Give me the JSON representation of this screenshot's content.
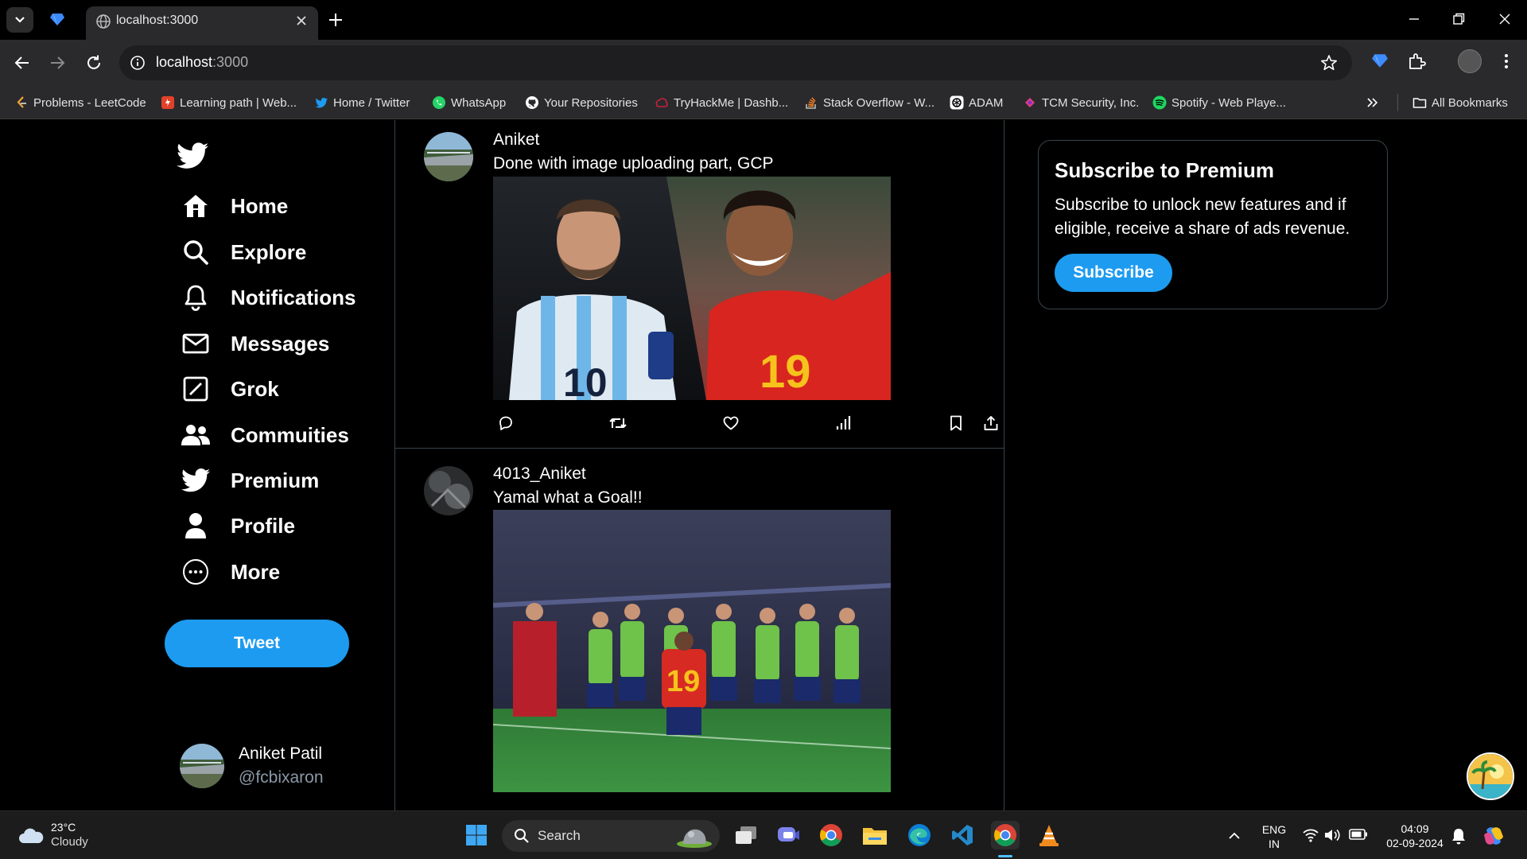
{
  "browser": {
    "tab": {
      "title": "localhost:3000"
    },
    "url": {
      "host": "localhost",
      "port": ":3000"
    },
    "bookmarks": [
      {
        "label": "Problems - LeetCode",
        "icon": "leetcode-icon"
      },
      {
        "label": "Learning path | Web...",
        "icon": "learning-icon"
      },
      {
        "label": "Home / Twitter",
        "icon": "twitter-icon"
      },
      {
        "label": "WhatsApp",
        "icon": "whatsapp-icon"
      },
      {
        "label": "Your Repositories",
        "icon": "github-icon"
      },
      {
        "label": "TryHackMe | Dashb...",
        "icon": "tryhackme-icon"
      },
      {
        "label": "Stack Overflow - W...",
        "icon": "stackoverflow-icon"
      },
      {
        "label": "ADAM",
        "icon": "openai-icon"
      },
      {
        "label": "TCM Security, Inc.",
        "icon": "tcm-icon"
      },
      {
        "label": "Spotify - Web Playe...",
        "icon": "spotify-icon"
      }
    ],
    "all_bookmarks": "All Bookmarks"
  },
  "sidebar": {
    "nav": [
      {
        "label": "Home",
        "icon": "home-icon"
      },
      {
        "label": "Explore",
        "icon": "search-icon"
      },
      {
        "label": "Notifications",
        "icon": "bell-icon"
      },
      {
        "label": "Messages",
        "icon": "mail-icon"
      },
      {
        "label": "Grok",
        "icon": "grok-icon"
      },
      {
        "label": "Commuities",
        "icon": "users-icon"
      },
      {
        "label": "Premium",
        "icon": "twitter-bird-icon"
      },
      {
        "label": "Profile",
        "icon": "person-icon"
      },
      {
        "label": "More",
        "icon": "more-icon"
      }
    ],
    "tweet_button": "Tweet",
    "profile": {
      "name": "Aniket Patil",
      "handle": "@fcbixaron"
    }
  },
  "feed": {
    "posts": [
      {
        "author": "Aniket",
        "text": "Done with image uploading part, GCP"
      },
      {
        "author": "4013_Aniket",
        "text": "Yamal what a Goal!!"
      }
    ]
  },
  "premium": {
    "title": "Subscribe to Premium",
    "description": "Subscribe to unlock new features and if eligible, receive a share of ads revenue.",
    "button": "Subscribe"
  },
  "taskbar": {
    "weather": {
      "temp": "23°C",
      "condition": "Cloudy"
    },
    "search_label": "Search",
    "lang": {
      "line1": "ENG",
      "line2": "IN"
    },
    "clock": {
      "time": "04:09",
      "date": "02-09-2024"
    }
  },
  "colors": {
    "accent": "#1d9bf0",
    "border": "#38444d",
    "background": "#000000"
  }
}
